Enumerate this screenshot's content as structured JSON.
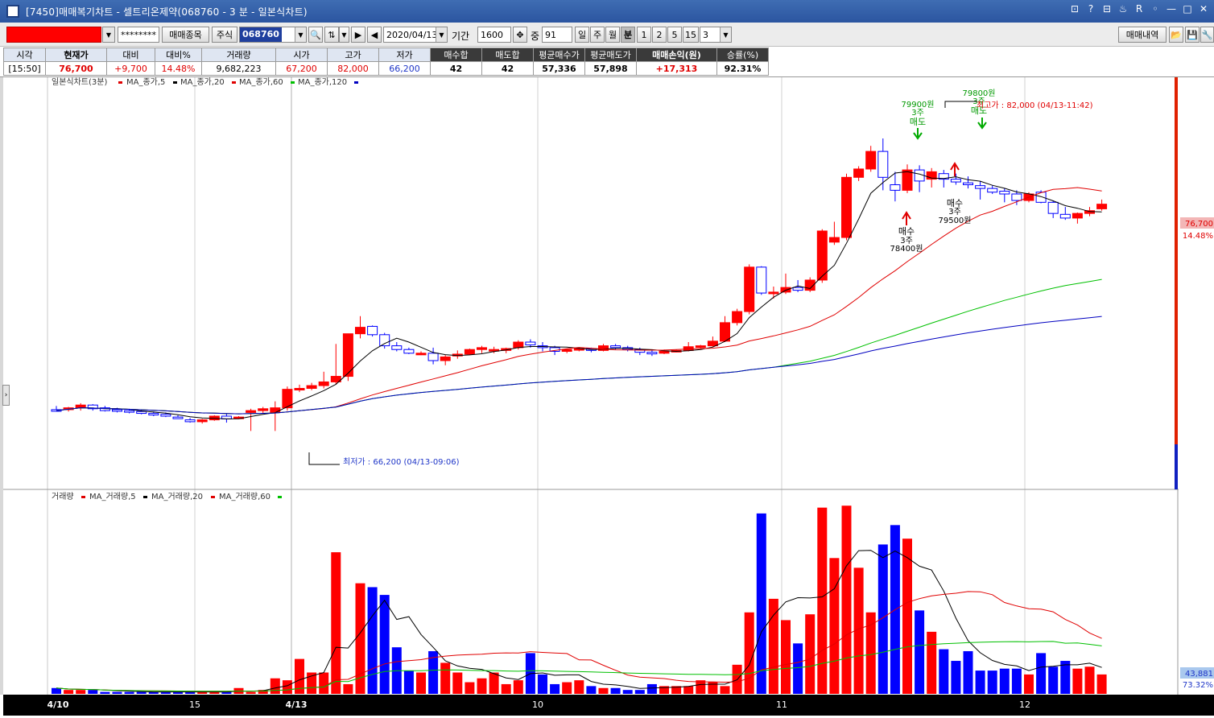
{
  "window": {
    "title": "[7450]매매복기차트 - 셀트리온제약(068760 - 3 분 - 일본식차트)",
    "controls": [
      "⊡",
      "?",
      "⊟",
      "♨",
      "R",
      "◦",
      "—",
      "□",
      "✕"
    ]
  },
  "toolbar": {
    "password": "********",
    "stock_select_button": "매매종목",
    "market_label": "주식",
    "code": "068760",
    "date": "2020/04/13",
    "period_label": "기간",
    "period_value": "1600",
    "mid_label": "중",
    "mid_value": "91",
    "period_buttons": [
      "일",
      "주",
      "월",
      "분",
      "1",
      "2",
      "5",
      "15"
    ],
    "active_period": "분",
    "minute_value": "3",
    "trade_history_button": "매매내역"
  },
  "info": {
    "headers": [
      "시각",
      "현재가",
      "대비",
      "대비%",
      "거래량",
      "시가",
      "고가",
      "저가",
      "매수합",
      "매도합",
      "평균매수가",
      "평균매도가",
      "매매손익(원)",
      "승률(%)"
    ],
    "values": [
      "[15:50]",
      "76,700",
      "+9,700",
      "14.48%",
      "9,682,223",
      "67,200",
      "82,000",
      "66,200",
      "42",
      "42",
      "57,336",
      "57,898",
      "+17,313",
      "92.31%"
    ]
  },
  "price_panel": {
    "legend_title": "일본식차트(3분)",
    "legend_items": [
      {
        "label": "MA_종가,5",
        "color": "#000000"
      },
      {
        "label": "MA_종가,20",
        "color": "#e00000"
      },
      {
        "label": "MA_종가,60",
        "color": "#00c000"
      },
      {
        "label": "MA_종가,120",
        "color": "#0000c0"
      }
    ],
    "annotations": {
      "high": "최고가 : 82,000 (04/13-11:42)",
      "low": "최저가 : 66,200 (04/13-09:06)",
      "sell1_price": "79900원",
      "sell1_qty": "3주",
      "sell1_label": "매도",
      "sell2_price": "79800원",
      "sell2_qty": "3주",
      "sell2_label": "매도",
      "buy1_label": "매수",
      "buy1_qty": "3주",
      "buy1_price": "78400원",
      "buy2_label": "매수",
      "buy2_qty": "3주",
      "buy2_price": "79500원"
    },
    "last_price": "76,700",
    "last_pct": "14.48%"
  },
  "volume_panel": {
    "legend_title": "거래량",
    "legend_items": [
      {
        "label": "MA_거래량,5",
        "color": "#000000"
      },
      {
        "label": "MA_거래량,20",
        "color": "#e00000"
      },
      {
        "label": "MA_거래량,60",
        "color": "#00c000"
      }
    ],
    "last_value": "43,881",
    "last_pct": "73.32%"
  },
  "time_axis": {
    "labels": [
      "4/10",
      "15",
      "4/13",
      "10",
      "11",
      "12"
    ]
  },
  "chart_data": {
    "type": "candlestick",
    "ylim": [
      64000,
      84000
    ],
    "candles": [
      {
        "o": 67350,
        "h": 67550,
        "l": 67250,
        "c": 67300
      },
      {
        "o": 67350,
        "h": 67500,
        "l": 67250,
        "c": 67450
      },
      {
        "o": 67450,
        "h": 67700,
        "l": 67300,
        "c": 67600
      },
      {
        "o": 67600,
        "h": 67650,
        "l": 67300,
        "c": 67400
      },
      {
        "o": 67450,
        "h": 67550,
        "l": 67250,
        "c": 67300
      },
      {
        "o": 67350,
        "h": 67450,
        "l": 67200,
        "c": 67300
      },
      {
        "o": 67300,
        "h": 67400,
        "l": 67150,
        "c": 67250
      },
      {
        "o": 67250,
        "h": 67350,
        "l": 67100,
        "c": 67150
      },
      {
        "o": 67150,
        "h": 67250,
        "l": 67000,
        "c": 67100
      },
      {
        "o": 67100,
        "h": 67200,
        "l": 66950,
        "c": 67000
      },
      {
        "o": 66950,
        "h": 67050,
        "l": 66850,
        "c": 66900
      },
      {
        "o": 66800,
        "h": 66900,
        "l": 66650,
        "c": 66700
      },
      {
        "o": 66700,
        "h": 66850,
        "l": 66600,
        "c": 66800
      },
      {
        "o": 66800,
        "h": 67050,
        "l": 66750,
        "c": 67000
      },
      {
        "o": 67000,
        "h": 67150,
        "l": 66650,
        "c": 66850
      },
      {
        "o": 66900,
        "h": 67000,
        "l": 66850,
        "c": 66950
      },
      {
        "o": 67200,
        "h": 67400,
        "l": 66200,
        "c": 67300
      },
      {
        "o": 67300,
        "h": 67500,
        "l": 67150,
        "c": 67400
      },
      {
        "o": 67200,
        "h": 67800,
        "l": 66200,
        "c": 67450
      },
      {
        "o": 67450,
        "h": 68600,
        "l": 67300,
        "c": 68450
      },
      {
        "o": 68450,
        "h": 68700,
        "l": 68300,
        "c": 68500
      },
      {
        "o": 68500,
        "h": 68800,
        "l": 68400,
        "c": 68650
      },
      {
        "o": 68650,
        "h": 69400,
        "l": 68500,
        "c": 68850
      },
      {
        "o": 68850,
        "h": 70900,
        "l": 68700,
        "c": 69150
      },
      {
        "o": 69150,
        "h": 69600,
        "l": 68900,
        "c": 71450
      },
      {
        "o": 71450,
        "h": 72400,
        "l": 71200,
        "c": 71800
      },
      {
        "o": 71850,
        "h": 71900,
        "l": 71300,
        "c": 71400
      },
      {
        "o": 71400,
        "h": 71500,
        "l": 70650,
        "c": 70800
      },
      {
        "o": 70800,
        "h": 71000,
        "l": 70500,
        "c": 70600
      },
      {
        "o": 70600,
        "h": 70700,
        "l": 70350,
        "c": 70400
      },
      {
        "o": 70400,
        "h": 70500,
        "l": 70300,
        "c": 70400
      },
      {
        "o": 70400,
        "h": 70700,
        "l": 69800,
        "c": 70000
      },
      {
        "o": 70000,
        "h": 70300,
        "l": 69750,
        "c": 70200
      },
      {
        "o": 70250,
        "h": 70550,
        "l": 70100,
        "c": 70350
      },
      {
        "o": 70350,
        "h": 70650,
        "l": 70300,
        "c": 70600
      },
      {
        "o": 70600,
        "h": 70800,
        "l": 70400,
        "c": 70700
      },
      {
        "o": 70550,
        "h": 70750,
        "l": 70400,
        "c": 70600
      },
      {
        "o": 70550,
        "h": 70700,
        "l": 70400,
        "c": 70650
      },
      {
        "o": 70700,
        "h": 71100,
        "l": 70600,
        "c": 71000
      },
      {
        "o": 71000,
        "h": 71150,
        "l": 70700,
        "c": 70850
      },
      {
        "o": 70800,
        "h": 71000,
        "l": 70500,
        "c": 70700
      },
      {
        "o": 70700,
        "h": 70800,
        "l": 70300,
        "c": 70500
      },
      {
        "o": 70500,
        "h": 70650,
        "l": 70400,
        "c": 70600
      },
      {
        "o": 70600,
        "h": 70700,
        "l": 70500,
        "c": 70650
      },
      {
        "o": 70650,
        "h": 70700,
        "l": 70450,
        "c": 70550
      },
      {
        "o": 70550,
        "h": 70900,
        "l": 70500,
        "c": 70800
      },
      {
        "o": 70800,
        "h": 70900,
        "l": 70600,
        "c": 70700
      },
      {
        "o": 70700,
        "h": 70800,
        "l": 70500,
        "c": 70600
      },
      {
        "o": 70600,
        "h": 70700,
        "l": 70300,
        "c": 70450
      },
      {
        "o": 70450,
        "h": 70550,
        "l": 70250,
        "c": 70400
      },
      {
        "o": 70400,
        "h": 70600,
        "l": 70350,
        "c": 70500
      },
      {
        "o": 70500,
        "h": 70600,
        "l": 70450,
        "c": 70550
      },
      {
        "o": 70550,
        "h": 71000,
        "l": 70500,
        "c": 70750
      },
      {
        "o": 70750,
        "h": 70850,
        "l": 70650,
        "c": 70800
      },
      {
        "o": 70800,
        "h": 71300,
        "l": 70750,
        "c": 71050
      },
      {
        "o": 71050,
        "h": 72400,
        "l": 71000,
        "c": 72050
      },
      {
        "o": 72050,
        "h": 72800,
        "l": 71900,
        "c": 72650
      },
      {
        "o": 72650,
        "h": 75200,
        "l": 72500,
        "c": 75050
      },
      {
        "o": 75050,
        "h": 75100,
        "l": 73550,
        "c": 73650
      },
      {
        "o": 73650,
        "h": 74000,
        "l": 73350,
        "c": 73700
      },
      {
        "o": 73700,
        "h": 74700,
        "l": 73600,
        "c": 73950
      },
      {
        "o": 73950,
        "h": 74350,
        "l": 73700,
        "c": 73800
      },
      {
        "o": 73800,
        "h": 74500,
        "l": 73700,
        "c": 74350
      },
      {
        "o": 74350,
        "h": 77100,
        "l": 74200,
        "c": 77000
      },
      {
        "o": 76400,
        "h": 77500,
        "l": 76250,
        "c": 76650
      },
      {
        "o": 76650,
        "h": 80100,
        "l": 76500,
        "c": 79900
      },
      {
        "o": 79900,
        "h": 80500,
        "l": 79700,
        "c": 80350
      },
      {
        "o": 80350,
        "h": 81600,
        "l": 80200,
        "c": 81300
      },
      {
        "o": 81300,
        "h": 82000,
        "l": 79200,
        "c": 79900
      },
      {
        "o": 79500,
        "h": 80200,
        "l": 78600,
        "c": 79200
      },
      {
        "o": 79200,
        "h": 80600,
        "l": 79050,
        "c": 80300
      },
      {
        "o": 80300,
        "h": 80550,
        "l": 79100,
        "c": 79700
      },
      {
        "o": 79800,
        "h": 80400,
        "l": 79350,
        "c": 80200
      },
      {
        "o": 80100,
        "h": 80300,
        "l": 79350,
        "c": 79800
      },
      {
        "o": 79800,
        "h": 80100,
        "l": 79500,
        "c": 79650
      },
      {
        "o": 79600,
        "h": 79950,
        "l": 79300,
        "c": 79500
      },
      {
        "o": 79450,
        "h": 79700,
        "l": 78700,
        "c": 79300
      },
      {
        "o": 79300,
        "h": 79450,
        "l": 79000,
        "c": 79100
      },
      {
        "o": 79150,
        "h": 79300,
        "l": 78550,
        "c": 79000
      },
      {
        "o": 79000,
        "h": 79200,
        "l": 78400,
        "c": 78650
      },
      {
        "o": 78650,
        "h": 79100,
        "l": 78550,
        "c": 79000
      },
      {
        "o": 79100,
        "h": 79200,
        "l": 78500,
        "c": 78550
      },
      {
        "o": 78550,
        "h": 78650,
        "l": 77700,
        "c": 77950
      },
      {
        "o": 77900,
        "h": 78300,
        "l": 77600,
        "c": 77700
      },
      {
        "o": 77700,
        "h": 78000,
        "l": 77400,
        "c": 77950
      },
      {
        "o": 77950,
        "h": 78300,
        "l": 77800,
        "c": 78100
      },
      {
        "o": 78200,
        "h": 78700,
        "l": 78100,
        "c": 78450
      }
    ],
    "volume_max": 100,
    "volumes": [
      3,
      2,
      2,
      2,
      1,
      1,
      1,
      1,
      1,
      1,
      1,
      1,
      1,
      1,
      1,
      3,
      1,
      2,
      8,
      7,
      18,
      11,
      11,
      73,
      5,
      57,
      55,
      51,
      24,
      12,
      11,
      22,
      16,
      11,
      6,
      8,
      11,
      5,
      7,
      21,
      10,
      5,
      6,
      7,
      4,
      3,
      3,
      2,
      2,
      5,
      4,
      4,
      4,
      7,
      6,
      4,
      15,
      42,
      93,
      49,
      38,
      26,
      41,
      96,
      70,
      97,
      65,
      42,
      77,
      87,
      80,
      43,
      32,
      23,
      17,
      22,
      12,
      12,
      13,
      13,
      10,
      21,
      14,
      17,
      13,
      14,
      10
    ]
  }
}
